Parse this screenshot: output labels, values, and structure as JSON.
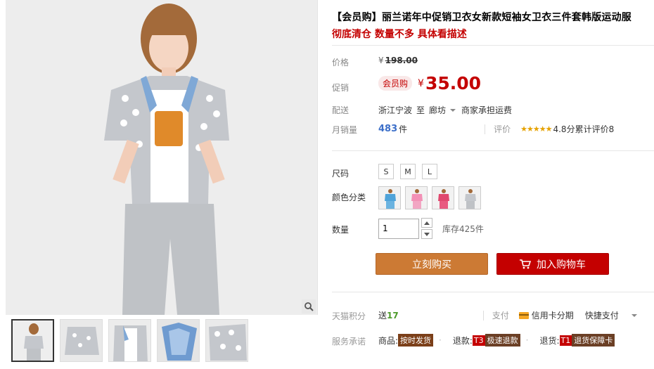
{
  "product": {
    "title": "【会员购】丽兰诺年中促销卫衣女新款短袖女卫衣三件套韩版运动服",
    "subtitle": "彻底清仓 数量不多 具体看描述"
  },
  "price": {
    "label": "价格",
    "currency": "¥",
    "value": "198.00"
  },
  "promo": {
    "label": "促销",
    "badge": "会员购",
    "currency": "¥",
    "value": "35.00"
  },
  "shipping": {
    "label": "配送",
    "from": "浙江宁波",
    "to_word": "至",
    "destination": "廊坊",
    "fee_note": "商家承担运费"
  },
  "sales": {
    "label": "月销量",
    "count": "483",
    "unit": "件",
    "rating_label": "评价",
    "stars": "★★★★★",
    "score": "4.8分",
    "reviews": "累计评价8"
  },
  "size": {
    "label": "尺码",
    "options": [
      "S",
      "M",
      "L"
    ]
  },
  "color": {
    "label": "颜色分类",
    "swatches": [
      "blue-swatch",
      "pink-swatch",
      "red-swatch",
      "grey-swatch"
    ]
  },
  "quantity": {
    "label": "数量",
    "value": "1",
    "stock": "库存425件"
  },
  "actions": {
    "buy_now": "立刻购买",
    "add_to_cart": "加入购物车"
  },
  "points": {
    "label": "天猫积分",
    "prefix": "送",
    "value": "17",
    "pay_label": "支付",
    "credit": "信用卡分期",
    "quick_pay": "快捷支付"
  },
  "service": {
    "label": "服务承诺",
    "item1_prefix": "商品:",
    "item1_tag": "按时发货",
    "item2_prefix": "退款:",
    "item2_code": "T3",
    "item2_tag": "极速退款",
    "item3_prefix": "退货:",
    "item3_code": "T1",
    "item3_tag": "退货保障卡"
  },
  "colors": {
    "accent_red": "#c40000",
    "buy_orange": "#cc7a34",
    "link_blue": "#3c6fc9"
  }
}
